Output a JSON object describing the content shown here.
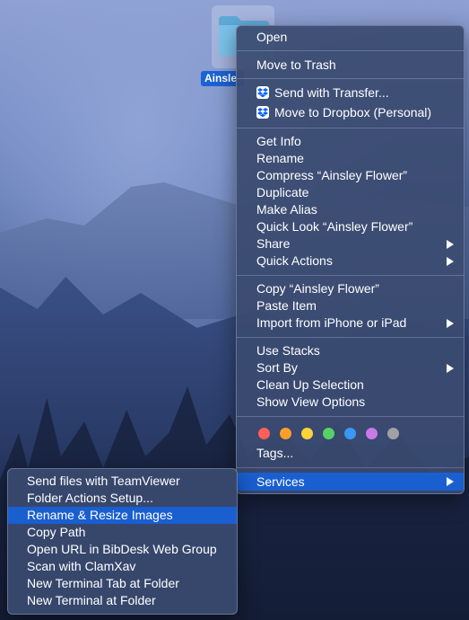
{
  "folder": {
    "label": "Ainsle"
  },
  "context_menu": {
    "items": [
      {
        "label": "Open"
      },
      {
        "label": "Move to Trash"
      },
      {
        "label": "Send with Transfer...",
        "icon": "dropbox-icon"
      },
      {
        "label": "Move to Dropbox (Personal)",
        "icon": "dropbox-icon"
      },
      {
        "label": "Get Info"
      },
      {
        "label": "Rename"
      },
      {
        "label": "Compress “Ainsley Flower”"
      },
      {
        "label": "Duplicate"
      },
      {
        "label": "Make Alias"
      },
      {
        "label": "Quick Look “Ainsley Flower”"
      },
      {
        "label": "Share",
        "submenu": true
      },
      {
        "label": "Quick Actions",
        "submenu": true
      },
      {
        "label": "Copy “Ainsley Flower”"
      },
      {
        "label": "Paste Item"
      },
      {
        "label": "Import from iPhone or iPad",
        "submenu": true
      },
      {
        "label": "Use Stacks"
      },
      {
        "label": "Sort By",
        "submenu": true
      },
      {
        "label": "Clean Up Selection"
      },
      {
        "label": "Show View Options"
      },
      {
        "label": "Tags..."
      },
      {
        "label": "Services",
        "submenu": true,
        "highlighted": true
      }
    ],
    "tag_colors": [
      "#fe5f57",
      "#fd9e2a",
      "#fdd33a",
      "#56d264",
      "#3a98f4",
      "#c77ae6",
      "#a1a1a5"
    ]
  },
  "services_menu": {
    "items": [
      {
        "label": "Send files with TeamViewer"
      },
      {
        "label": "Folder Actions Setup..."
      },
      {
        "label": "Rename & Resize Images",
        "highlighted": true
      },
      {
        "label": "Copy Path"
      },
      {
        "label": "Open URL in BibDesk Web Group"
      },
      {
        "label": "Scan with ClamXav"
      },
      {
        "label": "New Terminal Tab at Folder"
      },
      {
        "label": "New Terminal at Folder"
      }
    ]
  },
  "colors": {
    "highlight": "#1a5fd0",
    "menu_bg": "#3a4a70"
  }
}
